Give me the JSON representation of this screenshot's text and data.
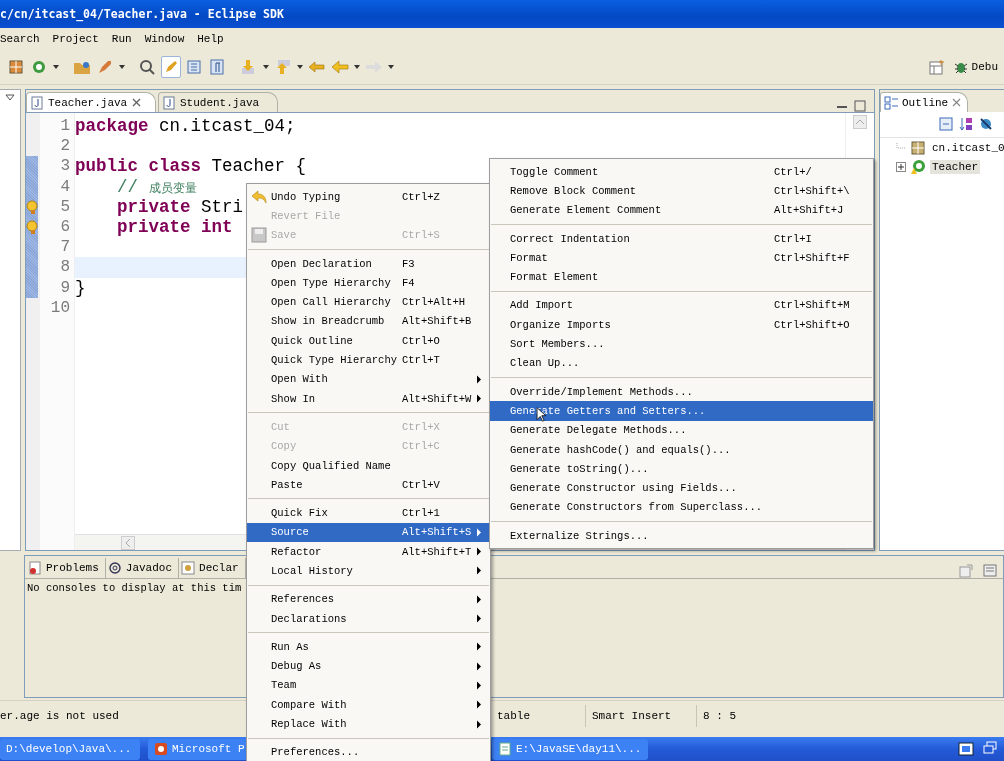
{
  "window": {
    "title": "c/cn/itcast_04/Teacher.java - Eclipse SDK"
  },
  "menu_bar": [
    "Search",
    "Project",
    "Run",
    "Window",
    "Help"
  ],
  "toolbar": {
    "perspective_label": "Debu"
  },
  "editor_tabs": [
    {
      "label": "Teacher.java",
      "selected": true
    },
    {
      "label": "Student.java",
      "selected": false
    }
  ],
  "code_lines": [
    {
      "number": "1",
      "current": false,
      "warning": false,
      "indented": false,
      "tokens": [
        {
          "text": "package",
          "kind": "keyword"
        },
        {
          "text": " cn.itcast_04;",
          "kind": "plain"
        }
      ]
    },
    {
      "number": "2",
      "current": false,
      "warning": false
    },
    {
      "number": "3",
      "current": false,
      "warning": false,
      "indented": false,
      "tokens": [
        {
          "text": "public class",
          "kind": "keyword"
        },
        {
          "text": " Teacher {",
          "kind": "plain"
        }
      ]
    },
    {
      "number": "4",
      "current": false,
      "warning": false,
      "indented": true,
      "tokens": [
        {
          "text": "// ",
          "kind": "comment"
        },
        {
          "text": "成员变量",
          "kind": "comment_cjk"
        }
      ]
    },
    {
      "number": "5",
      "current": false,
      "warning": true,
      "indented": true,
      "tokens": [
        {
          "text": "private",
          "kind": "keyword"
        },
        {
          "text": " Stri",
          "kind": "plain"
        }
      ]
    },
    {
      "number": "6",
      "current": false,
      "warning": true,
      "indented": true,
      "tokens": [
        {
          "text": "private int",
          "kind": "keyword"
        }
      ]
    },
    {
      "number": "7",
      "current": false,
      "warning": false
    },
    {
      "number": "8",
      "current": true,
      "warning": false
    },
    {
      "number": "9",
      "current": false,
      "warning": false,
      "indented": false,
      "tokens": [
        {
          "text": "}",
          "kind": "plain"
        }
      ]
    },
    {
      "number": "10",
      "current": false,
      "warning": false
    }
  ],
  "outline": {
    "title": "Outline",
    "tree": [
      {
        "label": "cn.itcast_0",
        "kind": "package",
        "selected": false
      },
      {
        "label": "Teacher",
        "kind": "class",
        "selected": true,
        "expanded": false
      }
    ]
  },
  "bottom_panel": {
    "tabs": [
      {
        "label": "Problems",
        "kind": "problems",
        "selected": false
      },
      {
        "label": "Javadoc",
        "kind": "javadoc",
        "selected": false
      },
      {
        "label": "Declar",
        "kind": "declaration",
        "selected": false
      }
    ],
    "message": "No consoles to display at this tim"
  },
  "context_menu": {
    "groups": [
      {
        "items": [
          {
            "label": "Undo Typing",
            "shortcut": "Ctrl+Z",
            "kind": "undo",
            "disabled": false,
            "selected": false,
            "submenu": false
          },
          {
            "label": "Revert File",
            "kind": "plain",
            "disabled": true,
            "selected": false,
            "submenu": false
          },
          {
            "label": "Save",
            "shortcut": "Ctrl+S",
            "kind": "save",
            "disabled": true,
            "selected": false,
            "submenu": false
          }
        ]
      },
      {
        "items": [
          {
            "label": "Open Declaration",
            "shortcut": "F3",
            "kind": "plain",
            "disabled": false,
            "selected": false,
            "submenu": false
          },
          {
            "label": "Open Type Hierarchy",
            "shortcut": "F4",
            "kind": "plain",
            "disabled": false,
            "selected": false,
            "submenu": false
          },
          {
            "label": "Open Call Hierarchy",
            "shortcut": "Ctrl+Alt+H",
            "kind": "plain",
            "disabled": false,
            "selected": false,
            "submenu": false
          },
          {
            "label": "Show in Breadcrumb",
            "shortcut": "Alt+Shift+B",
            "kind": "plain",
            "disabled": false,
            "selected": false,
            "submenu": false
          },
          {
            "label": "Quick Outline",
            "shortcut": "Ctrl+O",
            "kind": "plain",
            "disabled": false,
            "selected": false,
            "submenu": false
          },
          {
            "label": "Quick Type Hierarchy",
            "shortcut": "Ctrl+T",
            "kind": "plain",
            "disabled": false,
            "selected": false,
            "submenu": false
          },
          {
            "label": "Open With",
            "kind": "plain",
            "disabled": false,
            "selected": false,
            "submenu": true
          },
          {
            "label": "Show In",
            "shortcut": "Alt+Shift+W",
            "kind": "plain",
            "disabled": false,
            "selected": false,
            "submenu": true
          }
        ]
      },
      {
        "items": [
          {
            "label": "Cut",
            "shortcut": "Ctrl+X",
            "kind": "plain",
            "disabled": true,
            "selected": false,
            "submenu": false
          },
          {
            "label": "Copy",
            "shortcut": "Ctrl+C",
            "kind": "plain",
            "disabled": true,
            "selected": false,
            "submenu": false
          },
          {
            "label": "Copy Qualified Name",
            "kind": "plain",
            "disabled": false,
            "selected": false,
            "submenu": false
          },
          {
            "label": "Paste",
            "shortcut": "Ctrl+V",
            "kind": "plain",
            "disabled": false,
            "selected": false,
            "submenu": false
          }
        ]
      },
      {
        "items": [
          {
            "label": "Quick Fix",
            "shortcut": "Ctrl+1",
            "kind": "plain",
            "disabled": false,
            "selected": false,
            "submenu": false
          },
          {
            "label": "Source",
            "shortcut": "Alt+Shift+S",
            "kind": "plain",
            "disabled": false,
            "selected": true,
            "submenu": true
          },
          {
            "label": "Refactor",
            "shortcut": "Alt+Shift+T",
            "kind": "plain",
            "disabled": false,
            "selected": false,
            "submenu": true
          },
          {
            "label": "Local History",
            "kind": "plain",
            "disabled": false,
            "selected": false,
            "submenu": true
          }
        ]
      },
      {
        "items": [
          {
            "label": "References",
            "kind": "plain",
            "disabled": false,
            "selected": false,
            "submenu": true
          },
          {
            "label": "Declarations",
            "kind": "plain",
            "disabled": false,
            "selected": false,
            "submenu": true
          }
        ]
      },
      {
        "items": [
          {
            "label": "Run As",
            "kind": "plain",
            "disabled": false,
            "selected": false,
            "submenu": true
          },
          {
            "label": "Debug As",
            "kind": "plain",
            "disabled": false,
            "selected": false,
            "submenu": true
          },
          {
            "label": "Team",
            "kind": "plain",
            "disabled": false,
            "selected": false,
            "submenu": true
          },
          {
            "label": "Compare With",
            "kind": "plain",
            "disabled": false,
            "selected": false,
            "submenu": true
          },
          {
            "label": "Replace With",
            "kind": "plain",
            "disabled": false,
            "selected": false,
            "submenu": true
          }
        ]
      },
      {
        "items": [
          {
            "label": "Preferences...",
            "kind": "plain",
            "disabled": false,
            "selected": false,
            "submenu": false
          }
        ]
      }
    ]
  },
  "submenu": {
    "groups": [
      {
        "items": [
          {
            "label": "Toggle Comment",
            "shortcut": "Ctrl+/",
            "selected": false
          },
          {
            "label": "Remove Block Comment",
            "shortcut": "Ctrl+Shift+\\",
            "selected": false
          },
          {
            "label": "Generate Element Comment",
            "shortcut": "Alt+Shift+J",
            "selected": false
          }
        ]
      },
      {
        "items": [
          {
            "label": "Correct Indentation",
            "shortcut": "Ctrl+I",
            "selected": false
          },
          {
            "label": "Format",
            "shortcut": "Ctrl+Shift+F",
            "selected": false
          },
          {
            "label": "Format Element",
            "selected": false
          }
        ]
      },
      {
        "items": [
          {
            "label": "Add Import",
            "shortcut": "Ctrl+Shift+M",
            "selected": false
          },
          {
            "label": "Organize Imports",
            "shortcut": "Ctrl+Shift+O",
            "selected": false
          },
          {
            "label": "Sort Members...",
            "selected": false
          },
          {
            "label": "Clean Up...",
            "selected": false
          }
        ]
      },
      {
        "items": [
          {
            "label": "Override/Implement Methods...",
            "selected": false
          },
          {
            "label": "Generate Getters and Setters...",
            "selected": true
          },
          {
            "label": "Generate Delegate Methods...",
            "selected": false
          },
          {
            "label": "Generate hashCode() and equals()...",
            "selected": false
          },
          {
            "label": "Generate toString()...",
            "selected": false
          },
          {
            "label": "Generate Constructor using Fields...",
            "selected": false
          },
          {
            "label": "Generate Constructors from Superclass...",
            "selected": false
          }
        ]
      },
      {
        "items": [
          {
            "label": "Externalize Strings...",
            "selected": false
          }
        ]
      }
    ]
  },
  "status_bar": {
    "message": "er.age is not used",
    "fields": [
      "table",
      "Smart Insert",
      "8 : 5"
    ]
  },
  "taskbar": {
    "buttons": [
      {
        "label": "D:\\develop\\Java\\...",
        "kind": "folder"
      },
      {
        "label": "Microsoft P",
        "kind": "presentation"
      },
      {
        "label": "E:\\JavaSE\\day11\\...",
        "kind": "notepad"
      }
    ]
  }
}
